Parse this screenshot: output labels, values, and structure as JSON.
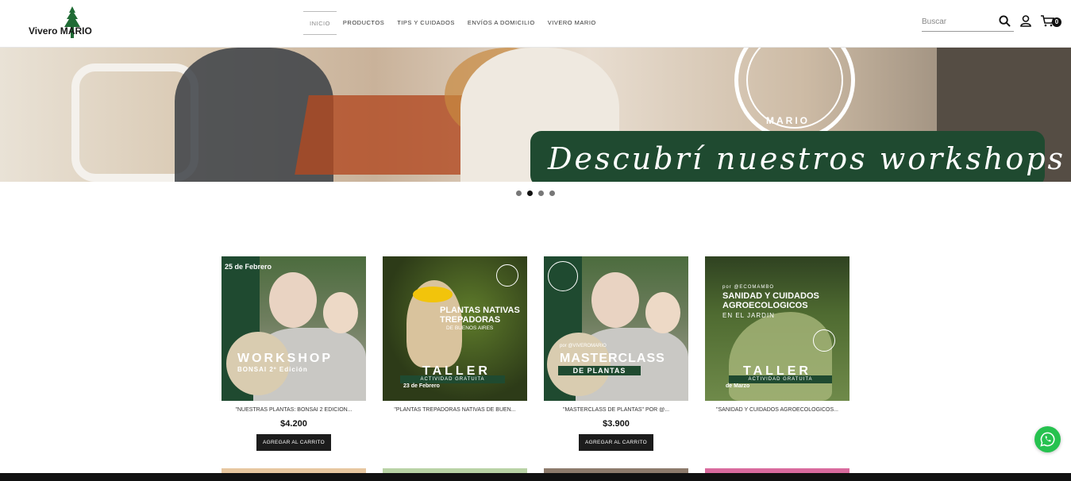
{
  "header": {
    "brand_first": "Vivero M",
    "brand_second": "ARIO",
    "nav": [
      "INICIO",
      "PRODUCTOS",
      "TIPS Y CUIDADOS",
      "ENVÍOS A DOMICILIO",
      "VIVERO MARIO"
    ],
    "search_placeholder": "Buscar",
    "cart_count": "0"
  },
  "hero": {
    "headline": "Descubrí nuestros workshops",
    "seal_text": "MARIO",
    "slides": 4,
    "active_slide": 2
  },
  "products": [
    {
      "name": "\"NUESTRAS PLANTAS: BONSAI 2 EDICIÓN...",
      "price": "$4.200",
      "button": "AGREGAR AL CARRITO",
      "art": {
        "date": "25 de Febrero",
        "title": "WORKSHOP",
        "sub": "BONSAI 2º Edición"
      }
    },
    {
      "name": "\"PLANTAS TREPADORAS NATIVAS DE BUEN...",
      "price": "",
      "button": "",
      "art": {
        "t1": "PLANTAS NATIVAS",
        "t2": "TREPADORAS",
        "t3": "DE BUENOS AIRES",
        "taller": "TALLER",
        "act": "ACTIVIDAD GRATUITA",
        "date": "23 de Febrero"
      }
    },
    {
      "name": "\"MASTERCLASS DE PLANTAS\" POR @...",
      "price": "$3.900",
      "button": "AGREGAR AL CARRITO",
      "art": {
        "by": "por @VIVEROMARIO",
        "title": "MASTERCLASS",
        "sub": "DE PLANTAS"
      }
    },
    {
      "name": "\"SANIDAD Y CUIDADOS AGROECOLÓGICOS...",
      "price": "",
      "button": "",
      "art": {
        "by": "por @ECOMAMBO",
        "t1": "SANIDAD Y CUIDADOS",
        "t2": "AGROECOLOGICOS",
        "t3": "EN EL JARDIN",
        "taller": "TALLER",
        "act": "ACTIVIDAD GRATUITA",
        "date": "de Marzo"
      }
    }
  ],
  "colors": {
    "brand_green": "#1f4a30",
    "button_dark": "#1c1c1c",
    "whatsapp": "#26c24f"
  }
}
